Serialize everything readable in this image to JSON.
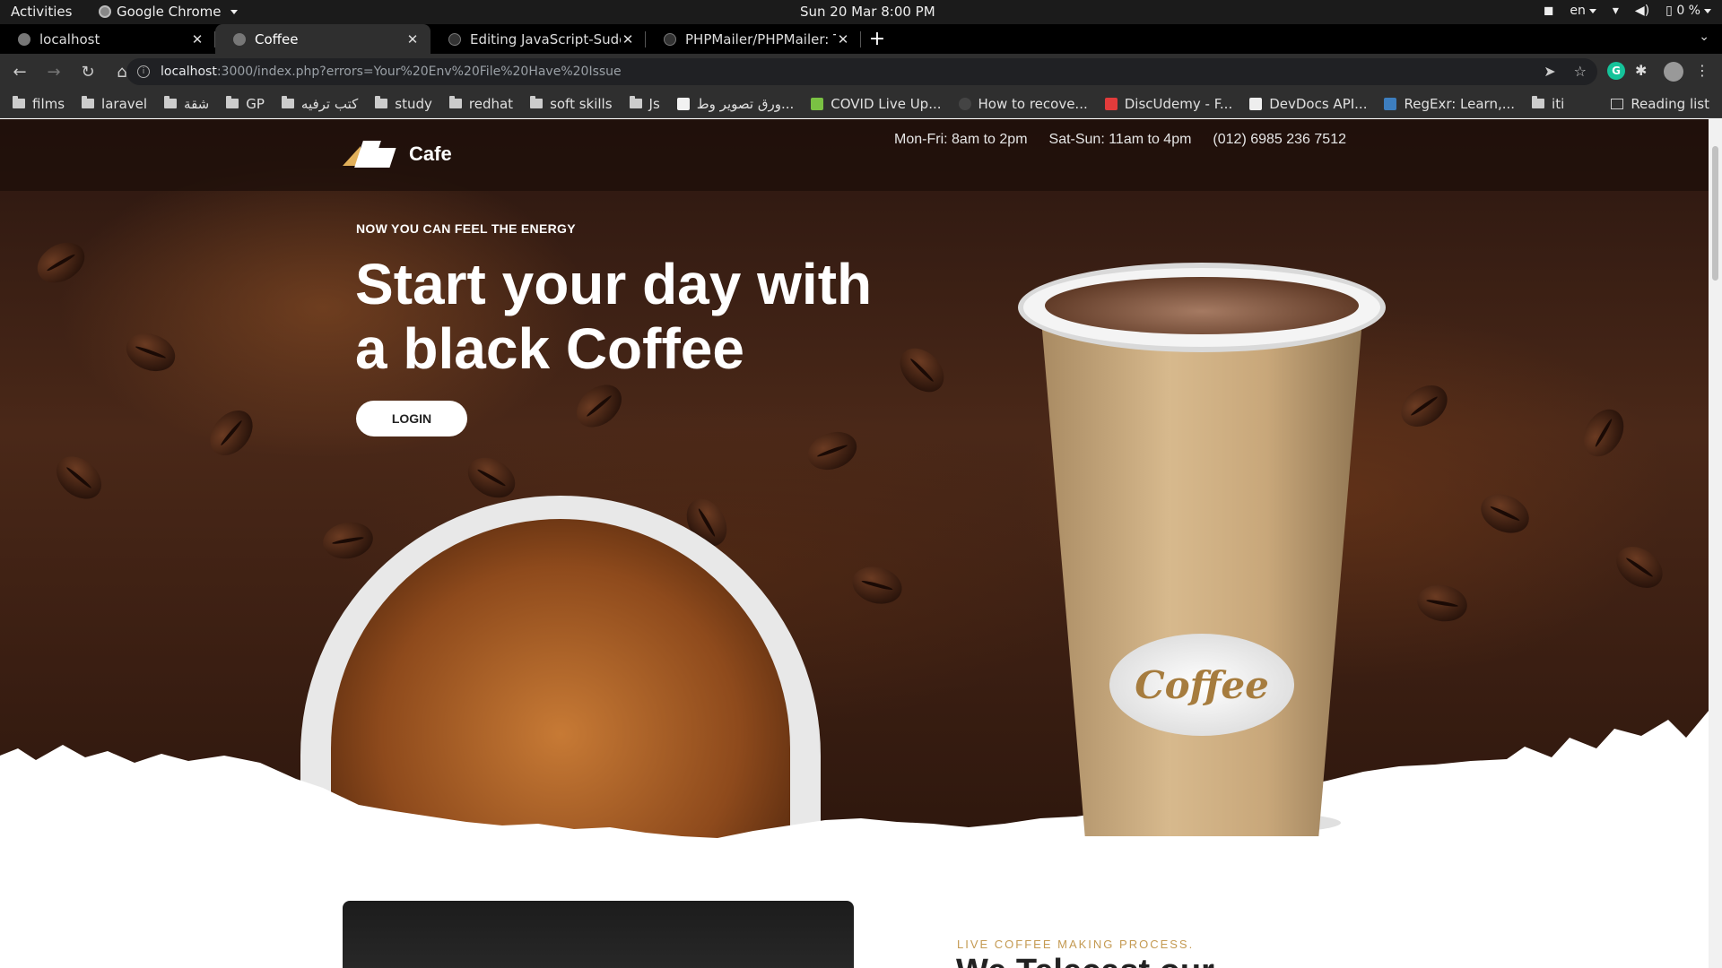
{
  "system_bar": {
    "activities": "Activities",
    "app_name": "Google Chrome",
    "clock": "Sun 20 Mar   8:00 PM",
    "language": "en",
    "battery": "0 %"
  },
  "tabs": [
    {
      "title": "localhost",
      "active": false
    },
    {
      "title": "Coffee",
      "active": true
    },
    {
      "title": "Editing JavaScript-Sudoku",
      "active": false
    },
    {
      "title": "PHPMailer/PHPMailer: Th",
      "active": false
    }
  ],
  "omnibox": {
    "host": "localhost",
    "path": ":3000/index.php?errors=Your%20Env%20File%20Have%20Issue"
  },
  "bookmarks": [
    {
      "label": "films",
      "type": "folder"
    },
    {
      "label": "laravel",
      "type": "folder"
    },
    {
      "label": "شقة",
      "type": "folder"
    },
    {
      "label": "GP",
      "type": "folder"
    },
    {
      "label": "كتب ترفيه",
      "type": "folder"
    },
    {
      "label": "study",
      "type": "folder"
    },
    {
      "label": "redhat",
      "type": "folder"
    },
    {
      "label": "soft skills",
      "type": "folder"
    },
    {
      "label": "Js",
      "type": "folder"
    },
    {
      "label": "ورق تصوير وط...",
      "type": "site",
      "color": "#f2f2f2"
    },
    {
      "label": "COVID Live Up...",
      "type": "site",
      "color": "#7ac143"
    },
    {
      "label": "How to recove...",
      "type": "site",
      "color": "#444444"
    },
    {
      "label": "DiscUdemy - F...",
      "type": "site",
      "color": "#e23b3b"
    },
    {
      "label": "DevDocs API...",
      "type": "site",
      "color": "#eeeeee"
    },
    {
      "label": "RegExr: Learn,...",
      "type": "site",
      "color": "#3d7ebf"
    },
    {
      "label": "iti",
      "type": "folder"
    }
  ],
  "reading_list": "Reading list",
  "site": {
    "logo_text": "Cafe",
    "hours_weekdays": "Mon-Fri: 8am to 2pm",
    "hours_weekend": "Sat-Sun: 11am to 4pm",
    "phone": "(012) 6985 236 7512",
    "eyebrow": "NOW YOU CAN FEEL THE ENERGY",
    "headline_line1": "Start your day with",
    "headline_line2": "a black Coffee",
    "login_label": "LOGIN",
    "cup_label": "Coffee",
    "section_eyebrow": "LIVE COFFEE MAKING PROCESS.",
    "section_title": "We Telecast our"
  },
  "colors": {
    "accent_gold": "#c49a52",
    "logo_gold": "#e2b05a",
    "chrome_dark": "#2f2f2f"
  }
}
